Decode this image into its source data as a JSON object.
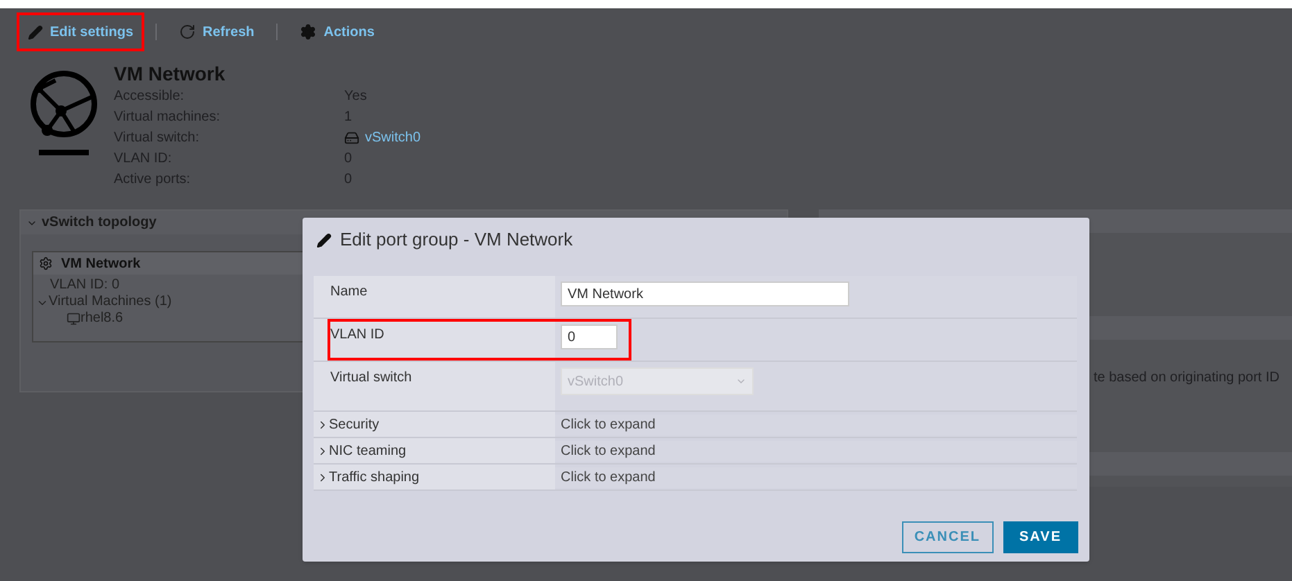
{
  "toolbar": [
    {
      "label": "Edit settings",
      "highlighted": true
    },
    {
      "label": "Refresh",
      "highlighted": false
    },
    {
      "label": "Actions",
      "highlighted": false
    }
  ],
  "header": {
    "title": "VM Network",
    "properties": [
      {
        "label": "Accessible:",
        "value": "Yes",
        "kind": "text"
      },
      {
        "label": "Virtual machines:",
        "value": "1",
        "kind": "text"
      },
      {
        "label": "Virtual switch:",
        "value": "vSwitch0",
        "kind": "link"
      },
      {
        "label": "VLAN ID:",
        "value": "0",
        "kind": "text"
      },
      {
        "label": "Active ports:",
        "value": "0",
        "kind": "text"
      }
    ]
  },
  "topology": {
    "title": "vSwitch topology",
    "expanded": true,
    "card": {
      "title": "VM Network",
      "vlan": "VLAN ID: 0",
      "group": {
        "label": "Virtual Machines (1)",
        "expanded": true,
        "children": [
          {
            "label": "rhel8.6"
          }
        ]
      }
    }
  },
  "right_panel": {
    "text": "te based on originating port ID"
  },
  "dialog": {
    "title": "Edit port group - VM Network",
    "fields": [
      {
        "label": "Name",
        "kind": "input",
        "value": "VM Network",
        "highlighted": false,
        "disabled": false
      },
      {
        "label": "VLAN ID",
        "kind": "input",
        "value": "0",
        "highlighted": true,
        "disabled": false
      },
      {
        "label": "Virtual switch",
        "kind": "select",
        "value": "vSwitch0",
        "highlighted": false,
        "disabled": true
      },
      {
        "label": "Security",
        "kind": "section",
        "value": "Click to expand",
        "expanded": false
      },
      {
        "label": "NIC teaming",
        "kind": "section",
        "value": "Click to expand",
        "expanded": false
      },
      {
        "label": "Traffic shaping",
        "kind": "section",
        "value": "Click to expand",
        "expanded": false
      }
    ],
    "buttons": [
      {
        "label": "CANCEL",
        "kind": "secondary"
      },
      {
        "label": "SAVE",
        "kind": "primary"
      }
    ]
  }
}
